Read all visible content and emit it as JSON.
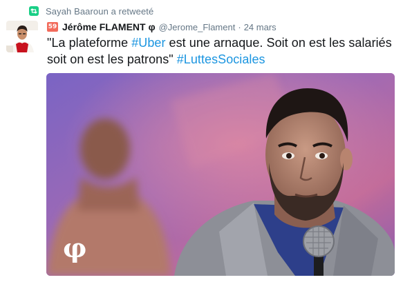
{
  "retweet": {
    "text": "Sayah Baaroun a retweeté",
    "icon": "retweet-icon"
  },
  "author": {
    "badge": "59",
    "name": "Jérôme FLAMENT",
    "symbol": "φ",
    "handle": "@Jerome_Flament",
    "separator": "·",
    "date": "24 mars"
  },
  "tweet": {
    "text_part1": "\"La plateforme ",
    "hashtag1": "#Uber",
    "text_part2": " est une arnaque. Soit on est les salariés soit on est les patrons\" ",
    "hashtag2": "#LuttesSociales"
  },
  "media": {
    "watermark": "φ"
  },
  "colors": {
    "hashtag": "#1b95e0",
    "retweet_green": "#19cf86",
    "badge_red": "#f26b5b",
    "muted": "#657786"
  }
}
